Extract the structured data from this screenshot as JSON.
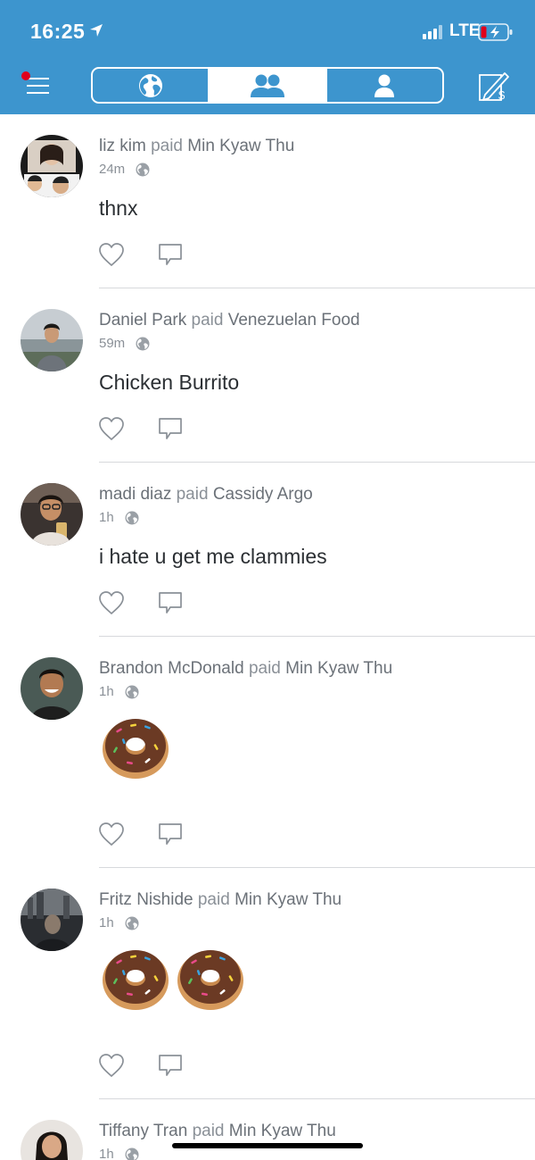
{
  "status_bar": {
    "time": "16:25",
    "network": "LTE"
  },
  "colors": {
    "brand": "#3d95ce",
    "text_primary": "#2b2f33",
    "text_secondary": "#6b7178",
    "divider": "#d7d9dc",
    "notification_dot": "#e0001b"
  },
  "nav": {
    "tabs": [
      {
        "icon": "globe-icon",
        "active": false
      },
      {
        "icon": "friends-icon",
        "active": true
      },
      {
        "icon": "person-icon",
        "active": false
      }
    ]
  },
  "feed": [
    {
      "actor": "liz kim",
      "verb": "paid",
      "target": "Min Kyaw Thu",
      "time": "24m",
      "note": "thnx"
    },
    {
      "actor": "Daniel Park",
      "verb": "paid",
      "target": "Venezuelan Food",
      "time": "59m",
      "note": "Chicken Burrito"
    },
    {
      "actor": "madi diaz",
      "verb": "paid",
      "target": "Cassidy Argo",
      "time": "1h",
      "note": "i hate u get me clammies"
    },
    {
      "actor": "Brandon McDonald",
      "verb": "paid",
      "target": "Min Kyaw Thu",
      "time": "1h",
      "note_emoji": "donut",
      "note_emoji_count": 1
    },
    {
      "actor": "Fritz Nishide",
      "verb": "paid",
      "target": "Min Kyaw Thu",
      "time": "1h",
      "note_emoji": "donut",
      "note_emoji_count": 2
    },
    {
      "actor": "Tiffany Tran",
      "verb": "paid",
      "target": "Min Kyaw Thu",
      "time": "1h"
    }
  ]
}
